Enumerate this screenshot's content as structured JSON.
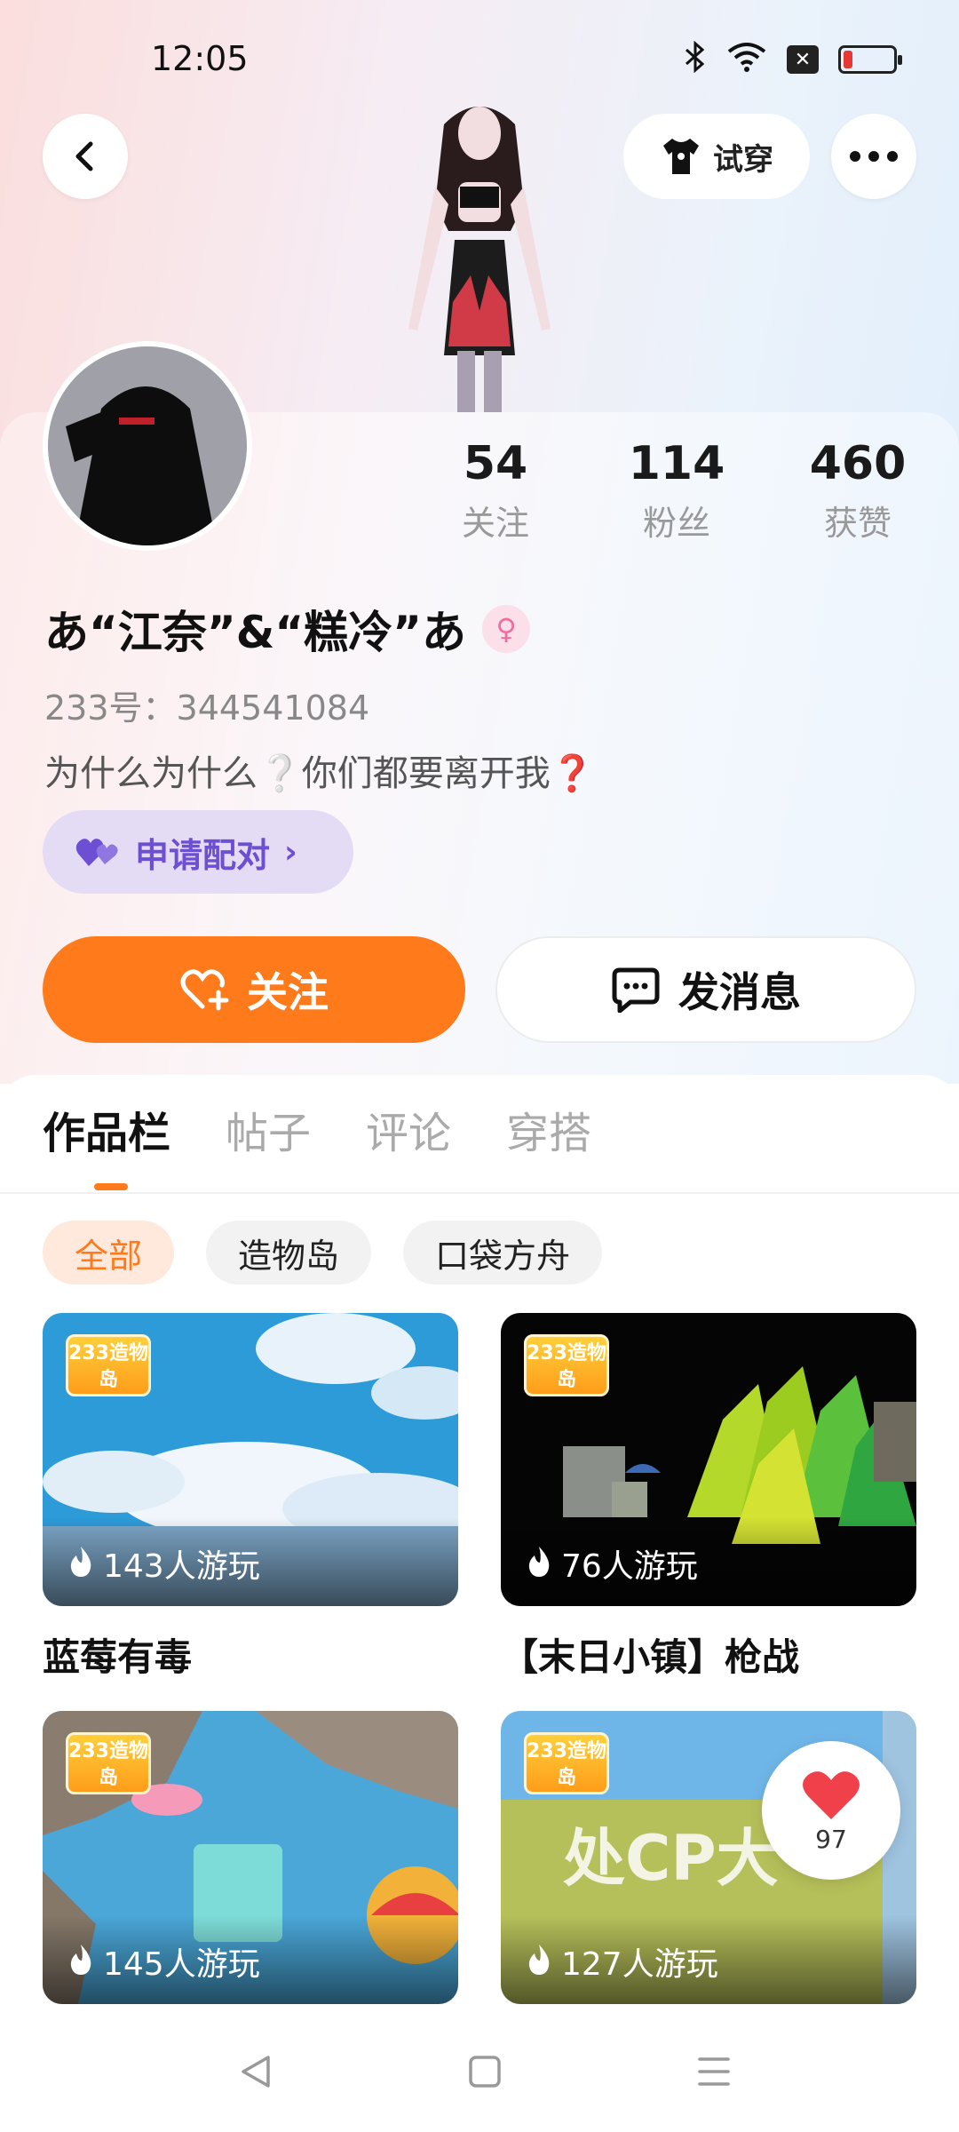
{
  "status_bar": {
    "time": "12:05",
    "icons": [
      "bluetooth-icon",
      "wifi-icon",
      "notification-icon",
      "battery-icon"
    ],
    "battery_color": "#e53935"
  },
  "header": {
    "try_on_label": "试穿",
    "back_icon": "chevron-left-icon",
    "more_icon": "more-horizontal-icon"
  },
  "profile": {
    "stats": [
      {
        "value": "54",
        "label": "关注"
      },
      {
        "value": "114",
        "label": "粉丝"
      },
      {
        "value": "460",
        "label": "获赞"
      }
    ],
    "nickname": "あ“江奈”&“糕冷”あ",
    "gender_icon": "female-icon",
    "uid": "233号：344541084",
    "bio": "为什么为什么❔你们都要离开我❓",
    "pair_button": "申请配对",
    "follow_button": "关注",
    "message_button": "发消息"
  },
  "tabs": [
    {
      "label": "作品栏",
      "active": true
    },
    {
      "label": "帖子",
      "active": false
    },
    {
      "label": "评论",
      "active": false
    },
    {
      "label": "穿搭",
      "active": false
    }
  ],
  "filters": [
    {
      "label": "全部",
      "active": true
    },
    {
      "label": "造物岛",
      "active": false
    },
    {
      "label": "口袋方舟",
      "active": false
    }
  ],
  "works": [
    {
      "players": "143人游玩",
      "title": "蓝莓有毒"
    },
    {
      "players": "76人游玩",
      "title": "【末日小镇】枪战"
    },
    {
      "players": "145人游玩",
      "title": ""
    },
    {
      "players": "127人游玩",
      "title": "",
      "banner_text": "处CP大"
    }
  ],
  "badge_logo": "233造物岛",
  "like_float": {
    "count": "97"
  },
  "colors": {
    "accent": "#ff7a1a",
    "pair": "#6d4fd3",
    "like": "#f0414a"
  }
}
